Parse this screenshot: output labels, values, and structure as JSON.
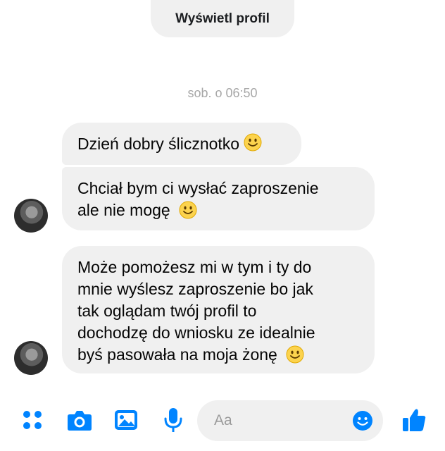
{
  "header": {
    "view_profile_label": "Wyświetl profil"
  },
  "conversation": {
    "timestamp": "sob. o 06:50",
    "messages": [
      {
        "text": "Dzień dobry ślicznotko",
        "emoji": "smile"
      },
      {
        "lines": [
          "Chciał bym ci wysłać zaproszenie",
          "ale nie mogę"
        ],
        "emoji": "smile"
      },
      {
        "lines": [
          "Może pomożesz mi w tym i ty do",
          "mnie wyślesz zaproszenie bo jak",
          "tak oglądam twój profil to",
          "dochodzę do wniosku ze idealnie",
          "byś pasowała na moja żonę"
        ],
        "emoji": "smile"
      }
    ]
  },
  "composer": {
    "placeholder": "Aa",
    "icons": [
      "menu-dots-icon",
      "camera-icon",
      "image-icon",
      "microphone-icon",
      "emoji-icon",
      "thumbs-up-icon"
    ]
  },
  "colors": {
    "accent": "#0084ff",
    "bubble_bg": "#f0f0f0",
    "emoji_yellow": "#fcd34d"
  }
}
